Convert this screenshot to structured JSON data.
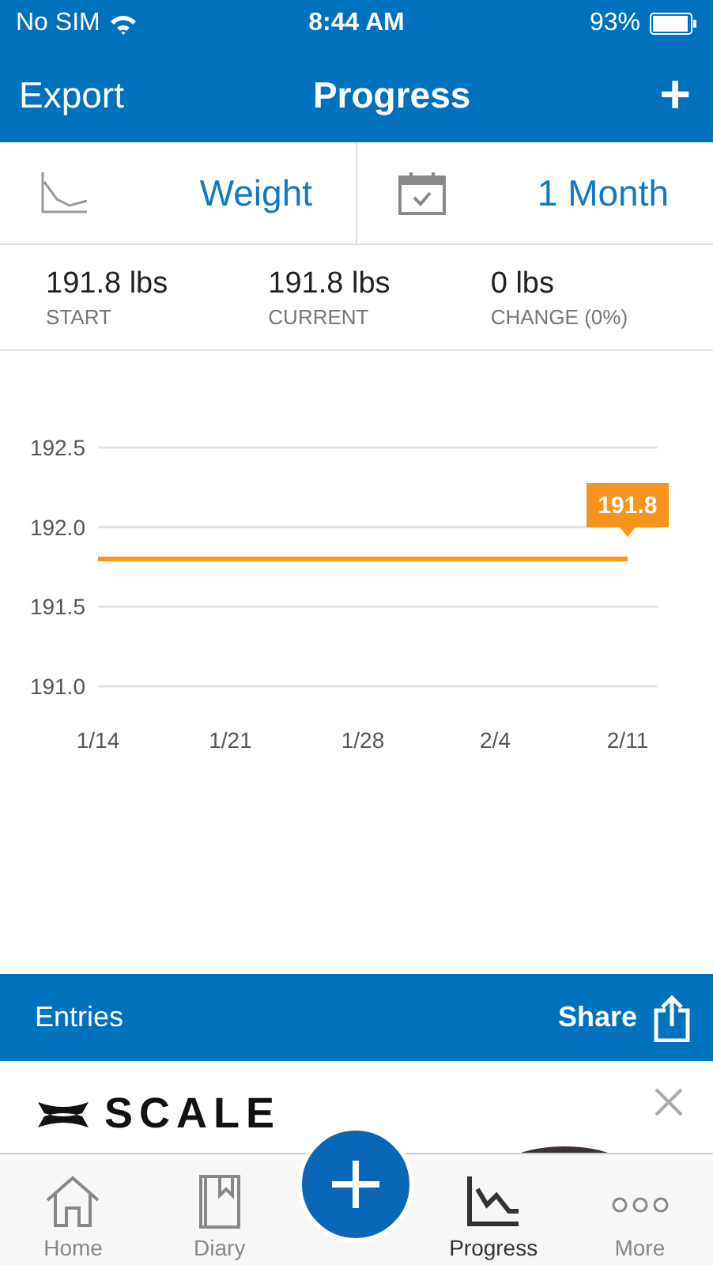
{
  "status_bar": {
    "carrier": "No SIM",
    "time": "8:44 AM",
    "battery": "93%"
  },
  "nav": {
    "left": "Export",
    "title": "Progress",
    "right": "+"
  },
  "selectors": [
    {
      "kind": "metric",
      "value": "Weight"
    },
    {
      "kind": "range",
      "value": "1 Month"
    }
  ],
  "stats": [
    {
      "value": "191.8 lbs",
      "label": "START"
    },
    {
      "value": "191.8 lbs",
      "label": "CURRENT"
    },
    {
      "value": "0 lbs",
      "label": "CHANGE (0%)"
    }
  ],
  "chart_data": {
    "type": "line",
    "categories": [
      "1/14",
      "1/21",
      "1/28",
      "2/4",
      "2/11"
    ],
    "series": [
      {
        "color": "#f7941d",
        "values": [
          191.8,
          191.8,
          191.8,
          191.8,
          191.8
        ]
      }
    ],
    "grid": true,
    "ylim": [
      191,
      192.5
    ],
    "yticks": [
      {
        "value": 191,
        "label": "191.0"
      },
      {
        "value": 191.5,
        "label": "191.5"
      },
      {
        "value": 192,
        "label": "192.0"
      },
      {
        "value": 192.5,
        "label": "192.5"
      }
    ],
    "annotations": [
      {
        "x": "2/11",
        "y": 191.8,
        "text": "191.8"
      }
    ]
  },
  "entries_bar": {
    "title": "Entries",
    "action": "Share"
  },
  "ad": {
    "brand": "SCALE"
  },
  "tab_bar": [
    {
      "kind": "home",
      "label": "Home",
      "selected": false
    },
    {
      "kind": "diary",
      "label": "Diary",
      "selected": false
    },
    {
      "kind": "add",
      "selected": false
    },
    {
      "kind": "progress",
      "label": "Progress",
      "selected": true
    },
    {
      "kind": "more",
      "label": "More",
      "selected": false
    }
  ]
}
